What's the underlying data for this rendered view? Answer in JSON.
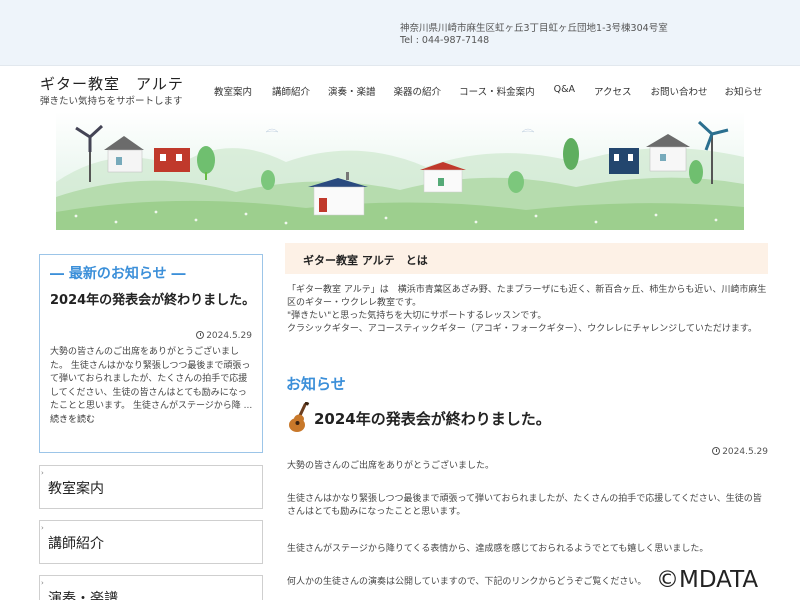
{
  "topbar": {
    "address": "神奈川県川崎市麻生区虹ヶ丘3丁目虹ヶ丘団地1-3号棟304号室",
    "tel": "Tel : 044-987-7148"
  },
  "site": {
    "title": "ギター教室　アルテ",
    "tagline": "弾きたい気持ちをサポートします"
  },
  "nav": {
    "items": [
      {
        "label": "教室案内"
      },
      {
        "label": "講師紹介"
      },
      {
        "label": "演奏・楽譜"
      },
      {
        "label": "楽器の紹介"
      },
      {
        "label": "コース・料金案内"
      },
      {
        "label": "Q&A"
      },
      {
        "label": "アクセス"
      },
      {
        "label": "お問い合わせ"
      },
      {
        "label": "お知らせ"
      }
    ]
  },
  "sidebar": {
    "news_heading": "― 最新のお知らせ ―",
    "news_title": "2024年の発表会が終わりました。",
    "news_date": "2024.5.29",
    "news_body": "大勢の皆さんのご出席をありがとうございました。 生徒さんはかなり緊張しつつ最後まで頑張って弾いておられましたが、たくさんの拍手で応援してください、生徒の皆さんはとても励みになったことと思います。 生徒さんがステージから降 ...",
    "news_more": "続きを読む",
    "menu": [
      {
        "label": "教室案内"
      },
      {
        "label": "講師紹介"
      },
      {
        "label": "演奏・楽譜"
      }
    ]
  },
  "main": {
    "about_title": "ギター教室 アルテ　とは",
    "about_lines": [
      "「ギター教室 アルテ」は　横浜市青葉区あざみ野、たまプラーザにも近く、新百合ヶ丘、柿生からも近い、川崎市麻生区のギター・ウクレレ教室です。",
      "\"弾きたい\"と思った気持ちを大切にサポートするレッスンです。",
      "クラシックギター、アコースティックギター（アコギ・フォークギター）、ウクレレにチャレンジしていただけます。"
    ],
    "news_heading": "お知らせ",
    "post_title": "2024年の発表会が終わりました。",
    "post_date": "2024.5.29",
    "paragraphs": [
      "大勢の皆さんのご出席をありがとうございました。",
      "生徒さんはかなり緊張しつつ最後まで頑張って弾いておられましたが、たくさんの拍手で応援してください、生徒の皆さんはとても励みになったことと思います。",
      "生徒さんがステージから降りてくる表情から、達成感を感じておられるようでとても嬉しく思いました。",
      "何人かの生徒さんの演奏は公開していますので、下記のリンクからどうぞご覧ください。"
    ]
  },
  "watermark": "©MDATA",
  "colors": {
    "accent_blue": "#3b8fd9",
    "about_bg": "#fdf1e6",
    "topbar_bg": "#eef4fa"
  }
}
